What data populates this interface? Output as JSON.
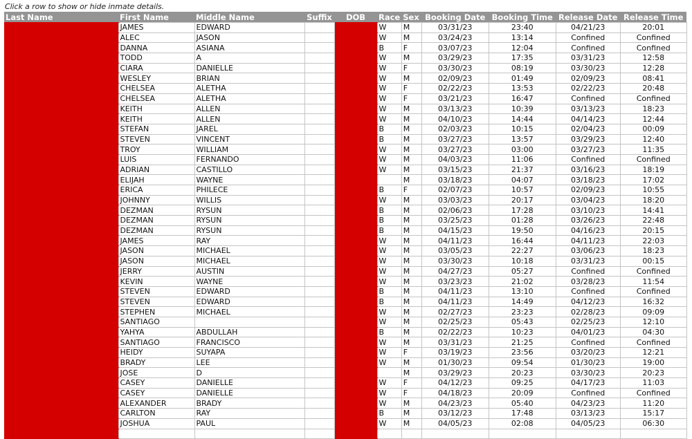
{
  "hint": "Click a row to show or hide inmate details.",
  "colors": {
    "header_bg": "#949494",
    "redaction": "#d40000",
    "grid": "#c4c4c4"
  },
  "columns": [
    "Last Name",
    "First Name",
    "Middle Name",
    "Suffix",
    "DOB",
    "Race",
    "Sex",
    "Booking Date",
    "Booking Time",
    "Release Date",
    "Release Time"
  ],
  "redacted_columns": [
    "Last Name",
    "DOB"
  ],
  "rows": [
    {
      "first": "JAMES",
      "middle": "EDWARD",
      "suffix": "",
      "race": "W",
      "sex": "M",
      "booking_date": "03/31/23",
      "booking_time": "23:40",
      "release_date": "04/21/23",
      "release_time": "20:01"
    },
    {
      "first": "ALEC",
      "middle": "JASON",
      "suffix": "",
      "race": "W",
      "sex": "M",
      "booking_date": "03/24/23",
      "booking_time": "13:14",
      "release_date": "Confined",
      "release_time": "Confined"
    },
    {
      "first": "DANNA",
      "middle": "ASIANA",
      "suffix": "",
      "race": "B",
      "sex": "F",
      "booking_date": "03/07/23",
      "booking_time": "12:04",
      "release_date": "Confined",
      "release_time": "Confined"
    },
    {
      "first": "TODD",
      "middle": "A",
      "suffix": "",
      "race": "W",
      "sex": "M",
      "booking_date": "03/29/23",
      "booking_time": "17:35",
      "release_date": "03/31/23",
      "release_time": "12:58"
    },
    {
      "first": "CIARA",
      "middle": "DANIELLE",
      "suffix": "",
      "race": "W",
      "sex": "F",
      "booking_date": "03/30/23",
      "booking_time": "08:19",
      "release_date": "03/30/23",
      "release_time": "12:28"
    },
    {
      "first": "WESLEY",
      "middle": "BRIAN",
      "suffix": "",
      "race": "W",
      "sex": "M",
      "booking_date": "02/09/23",
      "booking_time": "01:49",
      "release_date": "02/09/23",
      "release_time": "08:41"
    },
    {
      "first": "CHELSEA",
      "middle": "ALETHA",
      "suffix": "",
      "race": "W",
      "sex": "F",
      "booking_date": "02/22/23",
      "booking_time": "13:53",
      "release_date": "02/22/23",
      "release_time": "20:48"
    },
    {
      "first": "CHELSEA",
      "middle": "ALETHA",
      "suffix": "",
      "race": "W",
      "sex": "F",
      "booking_date": "03/21/23",
      "booking_time": "16:47",
      "release_date": "Confined",
      "release_time": "Confined"
    },
    {
      "first": "KEITH",
      "middle": "ALLEN",
      "suffix": "",
      "race": "W",
      "sex": "M",
      "booking_date": "03/13/23",
      "booking_time": "10:39",
      "release_date": "03/13/23",
      "release_time": "18:23"
    },
    {
      "first": "KEITH",
      "middle": "ALLEN",
      "suffix": "",
      "race": "W",
      "sex": "M",
      "booking_date": "04/10/23",
      "booking_time": "14:44",
      "release_date": "04/14/23",
      "release_time": "12:44"
    },
    {
      "first": "STEFAN",
      "middle": "JAREL",
      "suffix": "",
      "race": "B",
      "sex": "M",
      "booking_date": "02/03/23",
      "booking_time": "10:15",
      "release_date": "02/04/23",
      "release_time": "00:09"
    },
    {
      "first": "STEVEN",
      "middle": "VINCENT",
      "suffix": "",
      "race": "B",
      "sex": "M",
      "booking_date": "03/27/23",
      "booking_time": "13:57",
      "release_date": "03/29/23",
      "release_time": "12:40"
    },
    {
      "first": "TROY",
      "middle": "WILLIAM",
      "suffix": "",
      "race": "W",
      "sex": "M",
      "booking_date": "03/27/23",
      "booking_time": "03:00",
      "release_date": "03/27/23",
      "release_time": "11:35"
    },
    {
      "first": "LUIS",
      "middle": "FERNANDO",
      "suffix": "",
      "race": "W",
      "sex": "M",
      "booking_date": "04/03/23",
      "booking_time": "11:06",
      "release_date": "Confined",
      "release_time": "Confined"
    },
    {
      "first": "ADRIAN",
      "middle": "CASTILLO",
      "suffix": "",
      "race": "W",
      "sex": "M",
      "booking_date": "03/15/23",
      "booking_time": "21:37",
      "release_date": "03/16/23",
      "release_time": "18:19"
    },
    {
      "first": "ELIJAH",
      "middle": "WAYNE",
      "suffix": "",
      "race": "",
      "sex": "M",
      "booking_date": "03/18/23",
      "booking_time": "04:07",
      "release_date": "03/18/23",
      "release_time": "17:02"
    },
    {
      "first": "ERICA",
      "middle": "PHILECE",
      "suffix": "",
      "race": "B",
      "sex": "F",
      "booking_date": "02/07/23",
      "booking_time": "10:57",
      "release_date": "02/09/23",
      "release_time": "10:55"
    },
    {
      "first": "JOHNNY",
      "middle": "WILLIS",
      "suffix": "",
      "race": "W",
      "sex": "M",
      "booking_date": "03/03/23",
      "booking_time": "20:17",
      "release_date": "03/04/23",
      "release_time": "18:20"
    },
    {
      "first": "DEZMAN",
      "middle": "RYSUN",
      "suffix": "",
      "race": "B",
      "sex": "M",
      "booking_date": "02/06/23",
      "booking_time": "17:28",
      "release_date": "03/10/23",
      "release_time": "14:41"
    },
    {
      "first": "DEZMAN",
      "middle": "RYSUN",
      "suffix": "",
      "race": "B",
      "sex": "M",
      "booking_date": "03/25/23",
      "booking_time": "01:28",
      "release_date": "03/26/23",
      "release_time": "22:48"
    },
    {
      "first": "DEZMAN",
      "middle": "RYSUN",
      "suffix": "",
      "race": "B",
      "sex": "M",
      "booking_date": "04/15/23",
      "booking_time": "19:50",
      "release_date": "04/16/23",
      "release_time": "20:15"
    },
    {
      "first": "JAMES",
      "middle": "RAY",
      "suffix": "",
      "race": "W",
      "sex": "M",
      "booking_date": "04/11/23",
      "booking_time": "16:44",
      "release_date": "04/11/23",
      "release_time": "22:03"
    },
    {
      "first": "JASON",
      "middle": "MICHAEL",
      "suffix": "",
      "race": "W",
      "sex": "M",
      "booking_date": "03/05/23",
      "booking_time": "22:27",
      "release_date": "03/06/23",
      "release_time": "18:23"
    },
    {
      "first": "JASON",
      "middle": "MICHAEL",
      "suffix": "",
      "race": "W",
      "sex": "M",
      "booking_date": "03/30/23",
      "booking_time": "10:18",
      "release_date": "03/31/23",
      "release_time": "00:15"
    },
    {
      "first": "JERRY",
      "middle": "AUSTIN",
      "suffix": "",
      "race": "W",
      "sex": "M",
      "booking_date": "04/27/23",
      "booking_time": "05:27",
      "release_date": "Confined",
      "release_time": "Confined"
    },
    {
      "first": "KEVIN",
      "middle": "WAYNE",
      "suffix": "",
      "race": "W",
      "sex": "M",
      "booking_date": "03/23/23",
      "booking_time": "21:02",
      "release_date": "03/28/23",
      "release_time": "11:54"
    },
    {
      "first": "STEVEN",
      "middle": "EDWARD",
      "suffix": "",
      "race": "B",
      "sex": "M",
      "booking_date": "04/11/23",
      "booking_time": "13:10",
      "release_date": "Confined",
      "release_time": "Confined"
    },
    {
      "first": "STEVEN",
      "middle": "EDWARD",
      "suffix": "",
      "race": "B",
      "sex": "M",
      "booking_date": "04/11/23",
      "booking_time": "14:49",
      "release_date": "04/12/23",
      "release_time": "16:32"
    },
    {
      "first": "STEPHEN",
      "middle": "MICHAEL",
      "suffix": "",
      "race": "W",
      "sex": "M",
      "booking_date": "02/27/23",
      "booking_time": "23:23",
      "release_date": "02/28/23",
      "release_time": "09:09"
    },
    {
      "first": "SANTIAGO",
      "middle": "",
      "suffix": "",
      "race": "W",
      "sex": "M",
      "booking_date": "02/25/23",
      "booking_time": "05:43",
      "release_date": "02/25/23",
      "release_time": "12:10"
    },
    {
      "first": "YAHYA",
      "middle": "ABDULLAH",
      "suffix": "",
      "race": "B",
      "sex": "M",
      "booking_date": "02/22/23",
      "booking_time": "10:23",
      "release_date": "04/01/23",
      "release_time": "04:30"
    },
    {
      "first": "SANTIAGO",
      "middle": "FRANCISCO",
      "suffix": "",
      "race": "W",
      "sex": "M",
      "booking_date": "03/31/23",
      "booking_time": "21:25",
      "release_date": "Confined",
      "release_time": "Confined"
    },
    {
      "first": "HEIDY",
      "middle": "SUYAPA",
      "suffix": "",
      "race": "W",
      "sex": "F",
      "booking_date": "03/19/23",
      "booking_time": "23:56",
      "release_date": "03/20/23",
      "release_time": "12:21"
    },
    {
      "first": "BRADY",
      "middle": "LEE",
      "suffix": "",
      "race": "W",
      "sex": "M",
      "booking_date": "01/30/23",
      "booking_time": "09:54",
      "release_date": "01/30/23",
      "release_time": "19:00"
    },
    {
      "first": "JOSE",
      "middle": "D",
      "suffix": "",
      "race": "",
      "sex": "M",
      "booking_date": "03/29/23",
      "booking_time": "20:23",
      "release_date": "03/30/23",
      "release_time": "20:23"
    },
    {
      "first": "CASEY",
      "middle": "DANIELLE",
      "suffix": "",
      "race": "W",
      "sex": "F",
      "booking_date": "04/12/23",
      "booking_time": "09:25",
      "release_date": "04/17/23",
      "release_time": "11:03"
    },
    {
      "first": "CASEY",
      "middle": "DANIELLE",
      "suffix": "",
      "race": "W",
      "sex": "F",
      "booking_date": "04/18/23",
      "booking_time": "20:09",
      "release_date": "Confined",
      "release_time": "Confined"
    },
    {
      "first": "ALEXANDER",
      "middle": "BRADY",
      "suffix": "",
      "race": "W",
      "sex": "M",
      "booking_date": "04/23/23",
      "booking_time": "05:40",
      "release_date": "04/23/23",
      "release_time": "11:20"
    },
    {
      "first": "CARLTON",
      "middle": "RAY",
      "suffix": "",
      "race": "B",
      "sex": "M",
      "booking_date": "03/12/23",
      "booking_time": "17:48",
      "release_date": "03/13/23",
      "release_time": "15:17"
    },
    {
      "first": "JOSHUA",
      "middle": "PAUL",
      "suffix": "",
      "race": "W",
      "sex": "M",
      "booking_date": "04/05/23",
      "booking_time": "02:08",
      "release_date": "04/05/23",
      "release_time": "06:30"
    },
    {
      "first": "",
      "middle": "",
      "suffix": "",
      "race": "",
      "sex": "",
      "booking_date": "",
      "booking_time": "",
      "release_date": "",
      "release_time": ""
    }
  ]
}
